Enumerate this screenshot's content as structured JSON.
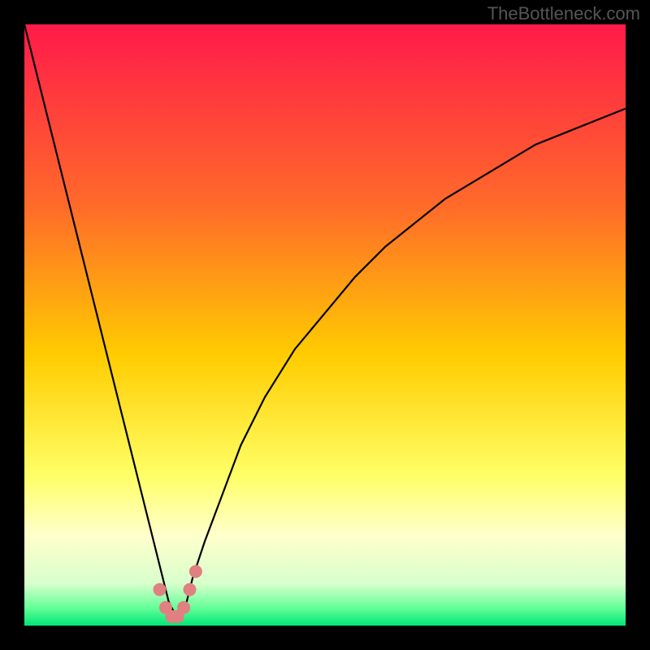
{
  "watermark": "TheBottleneck.com",
  "chart_data": {
    "type": "line",
    "title": "",
    "xlabel": "",
    "ylabel": "",
    "xlim": [
      0,
      100
    ],
    "ylim": [
      0,
      100
    ],
    "grid": false,
    "gradient_stops": [
      {
        "pos": 0.0,
        "color": "#ff1a4a"
      },
      {
        "pos": 0.3,
        "color": "#ff6a2a"
      },
      {
        "pos": 0.55,
        "color": "#ffcc00"
      },
      {
        "pos": 0.75,
        "color": "#ffff66"
      },
      {
        "pos": 0.85,
        "color": "#ffffcc"
      },
      {
        "pos": 0.93,
        "color": "#d8ffcc"
      },
      {
        "pos": 0.97,
        "color": "#66ff99"
      },
      {
        "pos": 1.0,
        "color": "#00e676"
      }
    ],
    "series": [
      {
        "name": "bottleneck-curve",
        "type": "line",
        "color": "#000000",
        "x": [
          0,
          2,
          4,
          6,
          8,
          10,
          12,
          14,
          16,
          18,
          20,
          22,
          23,
          24,
          25,
          26,
          27,
          28,
          30,
          33,
          36,
          40,
          45,
          50,
          55,
          60,
          65,
          70,
          75,
          80,
          85,
          90,
          95,
          100
        ],
        "y": [
          100,
          92,
          84,
          76,
          68,
          60,
          52,
          44,
          36,
          28,
          20,
          12,
          8,
          4,
          2,
          2,
          4,
          8,
          14,
          22,
          30,
          38,
          46,
          52,
          58,
          63,
          67,
          71,
          74,
          77,
          80,
          82,
          84,
          86
        ]
      },
      {
        "name": "highlight-markers",
        "type": "scatter",
        "color": "#e08080",
        "x": [
          22.5,
          23.5,
          24.5,
          25.5,
          26.5,
          27.5,
          28.5
        ],
        "y": [
          6,
          3,
          1.5,
          1.5,
          3,
          6,
          9
        ]
      }
    ]
  }
}
